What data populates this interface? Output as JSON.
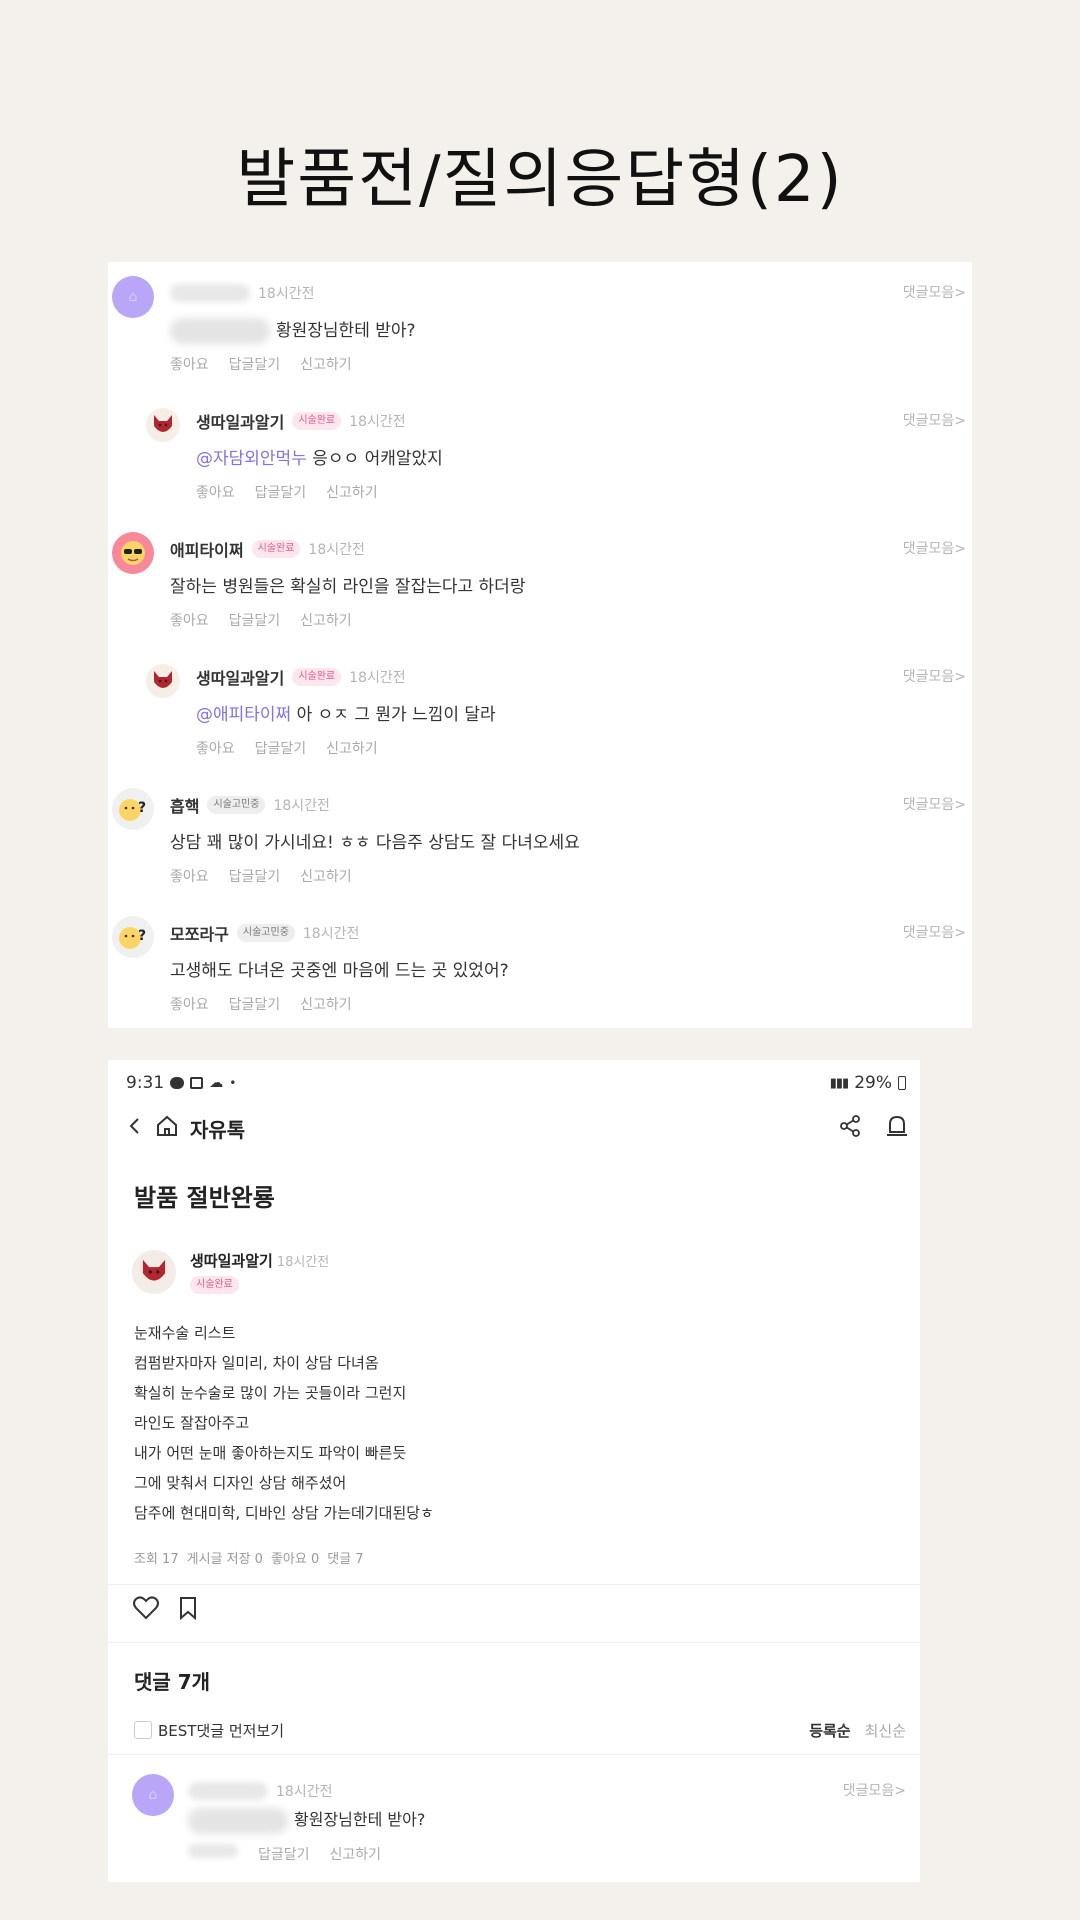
{
  "page_title": "발품전/질의응답형(2)",
  "comments": [
    {
      "nick": "",
      "badge": "",
      "time": "18시간전",
      "more": "댓글모음>",
      "mention": "",
      "text": "황원장님한테 받아?",
      "actions": [
        "좋아요",
        "답글달기",
        "신고하기"
      ]
    },
    {
      "nick": "생따일과알기",
      "badge": "시술완료",
      "time": "18시간전",
      "more": "댓글모음>",
      "mention": "@자담외안먹누",
      "text": "응ㅇㅇ 어캐알았지",
      "actions": [
        "좋아요",
        "답글달기",
        "신고하기"
      ]
    },
    {
      "nick": "애피타이쩌",
      "badge": "시술완료",
      "time": "18시간전",
      "more": "댓글모음>",
      "mention": "",
      "text": "잘하는 병원들은 확실히 라인을 잘잡는다고 하더랑",
      "actions": [
        "좋아요",
        "답글달기",
        "신고하기"
      ]
    },
    {
      "nick": "생따일과알기",
      "badge": "시술완료",
      "time": "18시간전",
      "more": "댓글모음>",
      "mention": "@애피타이쩌",
      "text": "아 ㅇㅈ 그 뭔가 느낌이 달라",
      "actions": [
        "좋아요",
        "답글달기",
        "신고하기"
      ]
    },
    {
      "nick": "흡핵",
      "badge": "시술고민중",
      "time": "18시간전",
      "more": "댓글모음>",
      "mention": "",
      "text": "상담 꽤 많이 가시네요! ㅎㅎ 다음주 상담도 잘 다녀오세요",
      "actions": [
        "좋아요",
        "답글달기",
        "신고하기"
      ]
    },
    {
      "nick": "모쪼라구",
      "badge": "시술고민중",
      "time": "18시간전",
      "more": "댓글모음>",
      "mention": "",
      "text": "고생해도 다녀온 곳중엔 마음에 드는 곳 있었어?",
      "actions": [
        "좋아요",
        "답글달기",
        "신고하기"
      ]
    }
  ],
  "phone": {
    "status_time": "9:31",
    "status_battery": "29%",
    "nav_title": "자유톡",
    "post_title": "발품 절반완룡",
    "author": {
      "name": "생따일과알기",
      "time": "18시간전",
      "badge": "시술완료"
    },
    "body_lines": [
      "눈재수술 리스트",
      "컴펌받자마자 일미리, 차이 상담 다녀옴",
      "확실히 눈수술로 많이 가는 곳들이라 그런지",
      "라인도 잘잡아주고",
      "내가 어떤 눈매 좋아하는지도 파악이 빠른듯",
      "그에 맞춰서 디자인 상담 해주셨어",
      "담주에 현대미학, 디바인 상담 가는데기대된당ㅎ"
    ],
    "stats": [
      "조회 17",
      "게시글 저장 0",
      "좋아요 0",
      "댓글 7"
    ],
    "comment_count": "댓글 7개",
    "best_label": "BEST댓글 먼저보기",
    "sort_on": "등록순",
    "sort_off": "최신순",
    "first_comment": {
      "time": "18시간전",
      "more": "댓글모음>",
      "text": "황원장님한테 받아?",
      "actions": [
        "답글달기",
        "신고하기"
      ]
    }
  },
  "colors": {
    "background": "#f4f0eb",
    "mention": "#8a6fe0",
    "badge_pink": "#e35d8c",
    "avatar_purple": "#b9a6f6"
  },
  "icons": [
    "back-icon",
    "home-icon",
    "share-icon",
    "bell-icon",
    "heart-icon",
    "bookmark-icon"
  ]
}
